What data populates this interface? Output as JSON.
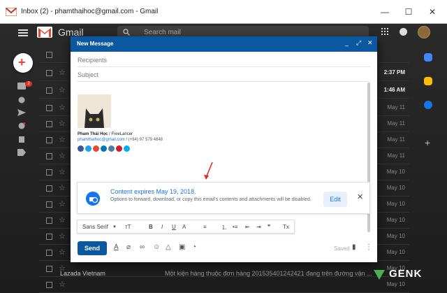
{
  "window": {
    "title": "Inbox (2) - phamthaihoc@gmail.com - Gmail",
    "min_glyph": "—",
    "max_glyph": "☐",
    "close_glyph": "✕"
  },
  "header": {
    "app_name": "Gmail",
    "search_placeholder": "Search mail"
  },
  "nav": {
    "inbox_badge": "2"
  },
  "mail_dates": [
    "2:37 PM",
    "1:46 AM",
    "May 11",
    "May 11",
    "May 11",
    "May 11",
    "May 10",
    "May 10",
    "May 10",
    "May 10",
    "May 10",
    "May 10",
    "May 10",
    "May 10"
  ],
  "last_row": {
    "from": "Lazada Vietnam",
    "subject": "Một kiện hàng thuộc đơn hàng 201535401242421 đang trên đường vận ..."
  },
  "compose": {
    "title": "New Message",
    "minimize": "_",
    "expand": "⤢",
    "close": "✕",
    "recipients": "Recipients",
    "subject": "Subject",
    "signature": {
      "name": "Pham Thái Học",
      "role": " / FreeLancer",
      "email": "phamthaihoc@gmail.com",
      "phone": " / (+84) 97 579 4848"
    },
    "confidential": {
      "heading": "Content expires May 19, 2018.",
      "description": "Options to forward, download, or copy this email's contents and attachments will be disabled.",
      "edit": "Edit",
      "close": "✕"
    },
    "format": {
      "font": "Sans Serif",
      "size": "тT",
      "bold": "B",
      "italic": "I",
      "underline": "U",
      "color": "A",
      "align": "≡",
      "numbered": "⒈",
      "bulleted": "•≡",
      "indent_less": "⇤",
      "indent_more": "⇥",
      "quote": "❞",
      "clear": "Tx"
    },
    "send": "Send",
    "saved": "Saved"
  },
  "watermark": "GENK",
  "colors": {
    "accent": "#0b57a0",
    "link": "#1a73e8",
    "alert": "#d93025"
  }
}
